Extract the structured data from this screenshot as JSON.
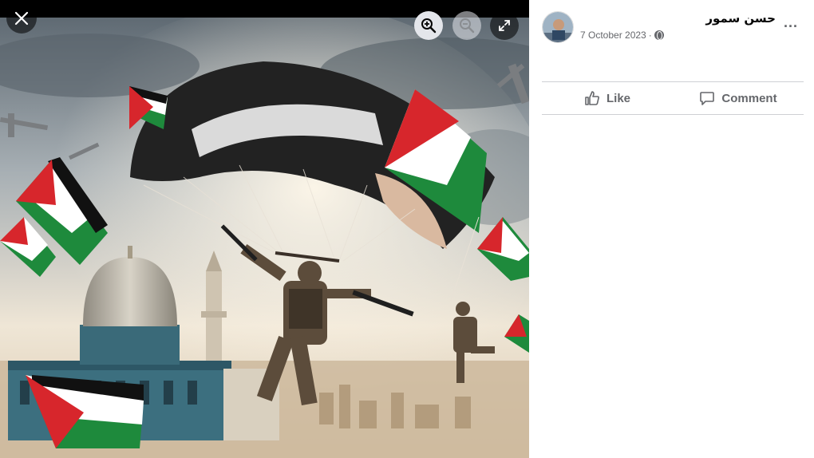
{
  "viewer": {
    "close_icon": "close-icon",
    "zoom_in_icon": "zoom-in-icon",
    "zoom_out_icon": "zoom-out-icon",
    "fullscreen_icon": "fullscreen-icon"
  },
  "post": {
    "author": "حسن سمور",
    "date": "7 October 2023",
    "date_separator": "·",
    "privacy_icon": "globe-icon",
    "more_label": "..."
  },
  "actions": {
    "like_label": "Like",
    "comment_label": "Comment"
  },
  "colors": {
    "flag_red": "#d7262c",
    "flag_green": "#1e8a3c",
    "flag_black": "#111111",
    "sky": "#c9ced2"
  }
}
